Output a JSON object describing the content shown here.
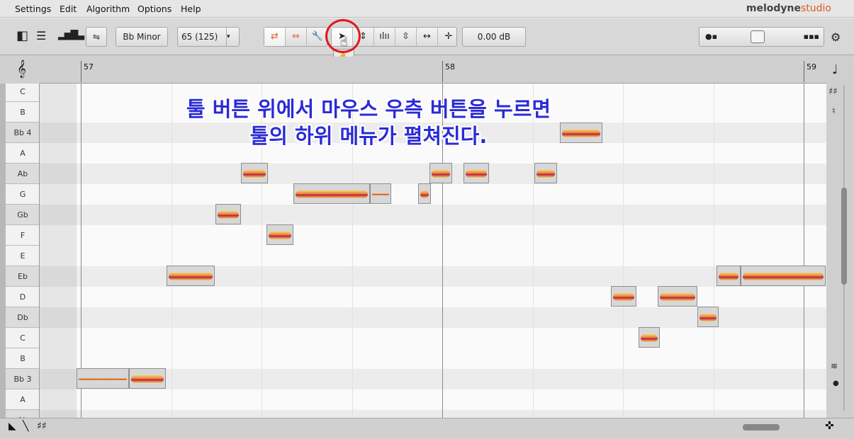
{
  "app": {
    "logo_main": "melodyne",
    "logo_sub": "studio"
  },
  "menu": [
    "Settings",
    "Edit",
    "Algorithm",
    "Options",
    "Help"
  ],
  "toolbar": {
    "key": "Bb Minor",
    "tempo": "65 (125)",
    "gain": "0.00 dB"
  },
  "ruler": {
    "bars": [
      "57",
      "58",
      "59"
    ]
  },
  "pitches": [
    "C",
    "B",
    "Bb 4",
    "A",
    "Ab",
    "G",
    "Gb",
    "F",
    "E",
    "Eb",
    "D",
    "Db",
    "C",
    "B",
    "Bb 3",
    "A",
    "Ab"
  ],
  "caption": {
    "line1": "툴 버튼 위에서 마우스 우측 버튼을 누르면",
    "line2": "툴의 하위 메뉴가 펼쳐진다."
  },
  "icons": {
    "clef": "treble-clef-icon",
    "submenu_zoom": "magnifier-icon",
    "submenu_scroll": "hand-icon",
    "selected_tool": "arrow-pointer-icon"
  }
}
